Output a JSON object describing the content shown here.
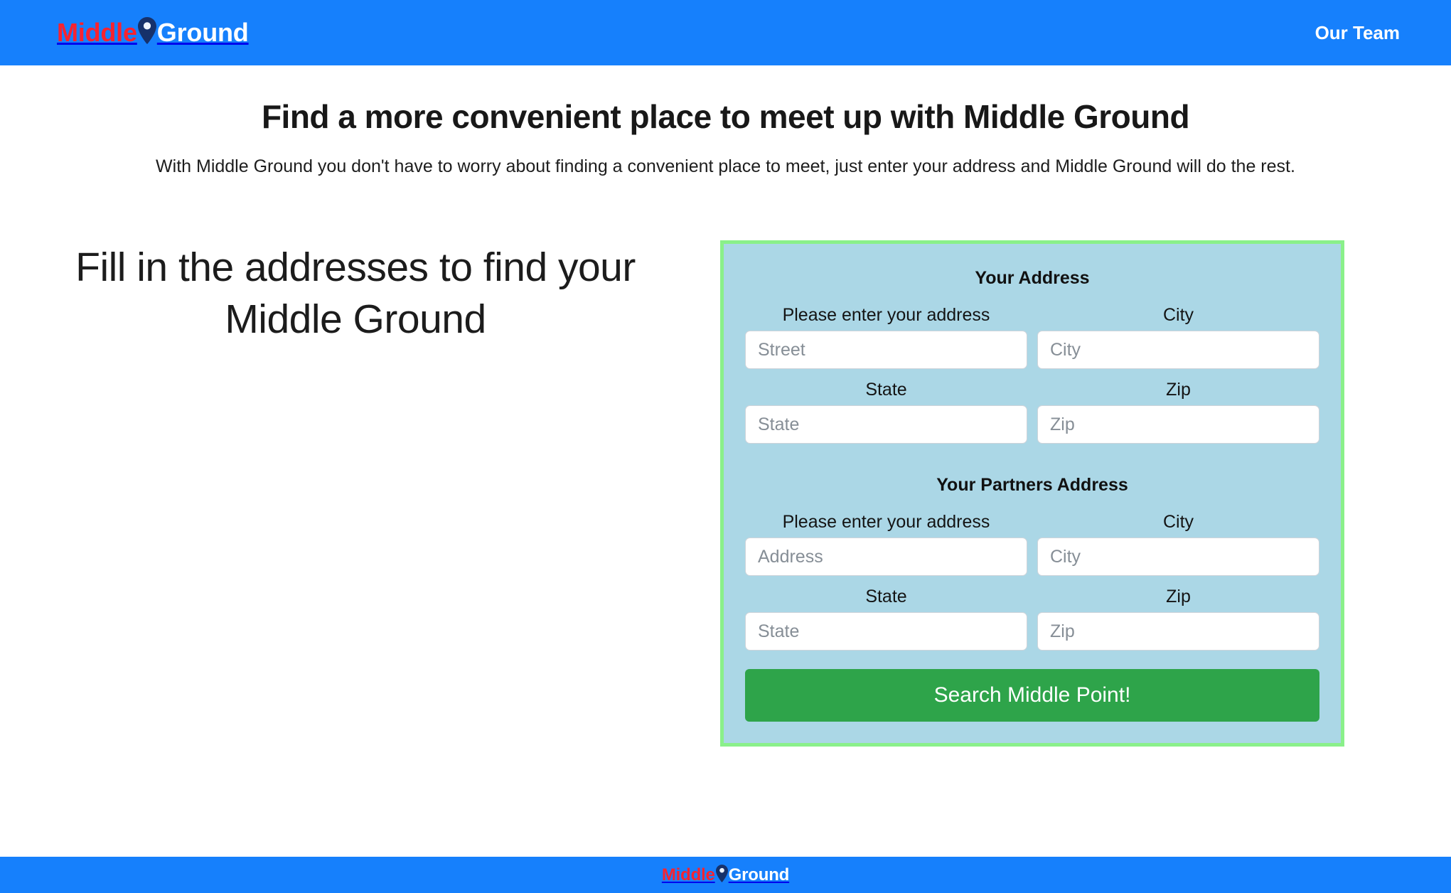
{
  "brand": {
    "part1": "Middle",
    "part2": "Ground",
    "pin_icon": "map-pin-icon",
    "color_part1": "#f8232f",
    "color_part2": "#ffffff",
    "pin_color": "#16316b"
  },
  "navbar": {
    "background": "#1680fc",
    "links": [
      {
        "label": "Our Team"
      }
    ]
  },
  "hero": {
    "title": "Find a more convenient place to meet up with Middle Ground",
    "subtitle": "With Middle Ground you don't have to worry about finding a convenient place to meet, just enter your address and Middle Ground will do the rest."
  },
  "left": {
    "heading": "Fill in the addresses to find your Middle Ground"
  },
  "form": {
    "card_background": "#abd7e6",
    "card_border": "#8af08a",
    "sections": [
      {
        "title": "Your Address",
        "rows": [
          {
            "fields": [
              {
                "label": "Please enter your address",
                "placeholder": "Street",
                "value": ""
              },
              {
                "label": "City",
                "placeholder": "City",
                "value": ""
              }
            ]
          },
          {
            "fields": [
              {
                "label": "State",
                "placeholder": "State",
                "value": ""
              },
              {
                "label": "Zip",
                "placeholder": "Zip",
                "value": ""
              }
            ]
          }
        ]
      },
      {
        "title": "Your Partners Address",
        "rows": [
          {
            "fields": [
              {
                "label": "Please enter your address",
                "placeholder": "Address",
                "value": ""
              },
              {
                "label": "City",
                "placeholder": "City",
                "value": ""
              }
            ]
          },
          {
            "fields": [
              {
                "label": "State",
                "placeholder": "State",
                "value": ""
              },
              {
                "label": "Zip",
                "placeholder": "Zip",
                "value": ""
              }
            ]
          }
        ]
      }
    ],
    "submit_label": "Search Middle Point!",
    "submit_color": "#2ea44a"
  },
  "footer": {
    "background": "#1680fc"
  }
}
